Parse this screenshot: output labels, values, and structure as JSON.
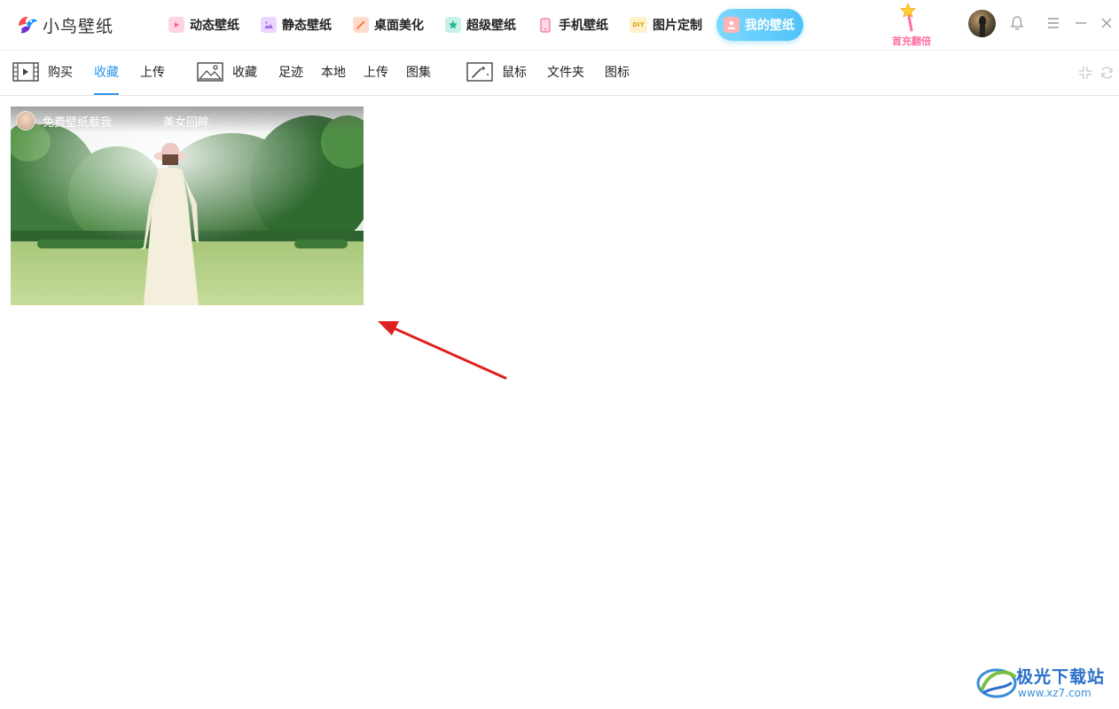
{
  "app": {
    "logo_text": "小鸟壁纸"
  },
  "nav": {
    "tabs": [
      {
        "label": "动态壁纸",
        "icon": "play-icon",
        "color": "#ff8fb5",
        "active": false
      },
      {
        "label": "静态壁纸",
        "icon": "image-icon",
        "color": "#c58cf0",
        "active": false
      },
      {
        "label": "桌面美化",
        "icon": "wand-icon",
        "color": "#ff9a6b",
        "active": false
      },
      {
        "label": "超级壁纸",
        "icon": "star-icon",
        "color": "#48c9b0",
        "active": false
      },
      {
        "label": "手机壁纸",
        "icon": "phone-icon",
        "color": "#f06fa8",
        "active": false
      },
      {
        "label": "图片定制",
        "icon": "diy-icon",
        "color": "#f5c24c",
        "active": false
      },
      {
        "label": "我的壁纸",
        "icon": "user-icon",
        "color": "#4fc3f7",
        "active": true
      }
    ],
    "diy_badge": "DIY"
  },
  "promo": {
    "text": "首充翻倍",
    "icon": "star-wand-icon"
  },
  "window": {
    "icons": [
      "bell-icon",
      "menu-icon",
      "minimize-icon",
      "close-icon"
    ]
  },
  "subnav": {
    "group_video": {
      "icon": "film-icon",
      "items": [
        "购买",
        "收藏",
        "上传"
      ],
      "active_index": 1
    },
    "group_image": {
      "icon": "picture-icon",
      "items": [
        "收藏",
        "足迹",
        "本地",
        "上传",
        "图集"
      ]
    },
    "group_cursor": {
      "icon": "cursor-wand-icon",
      "items": [
        "鼠标",
        "文件夹",
        "图标"
      ]
    },
    "right_icons": [
      "shrink-icon",
      "refresh-icon"
    ]
  },
  "content": {
    "cards": [
      {
        "author": "免费壁纸载我",
        "title": "美女回眸",
        "thumbnail": "woman-in-white-dress-on-lawn"
      }
    ]
  },
  "annotation": {
    "type": "red-arrow",
    "color": "#e02020"
  },
  "watermark": {
    "title": "极光下载站",
    "url": "www.xz7.com"
  }
}
